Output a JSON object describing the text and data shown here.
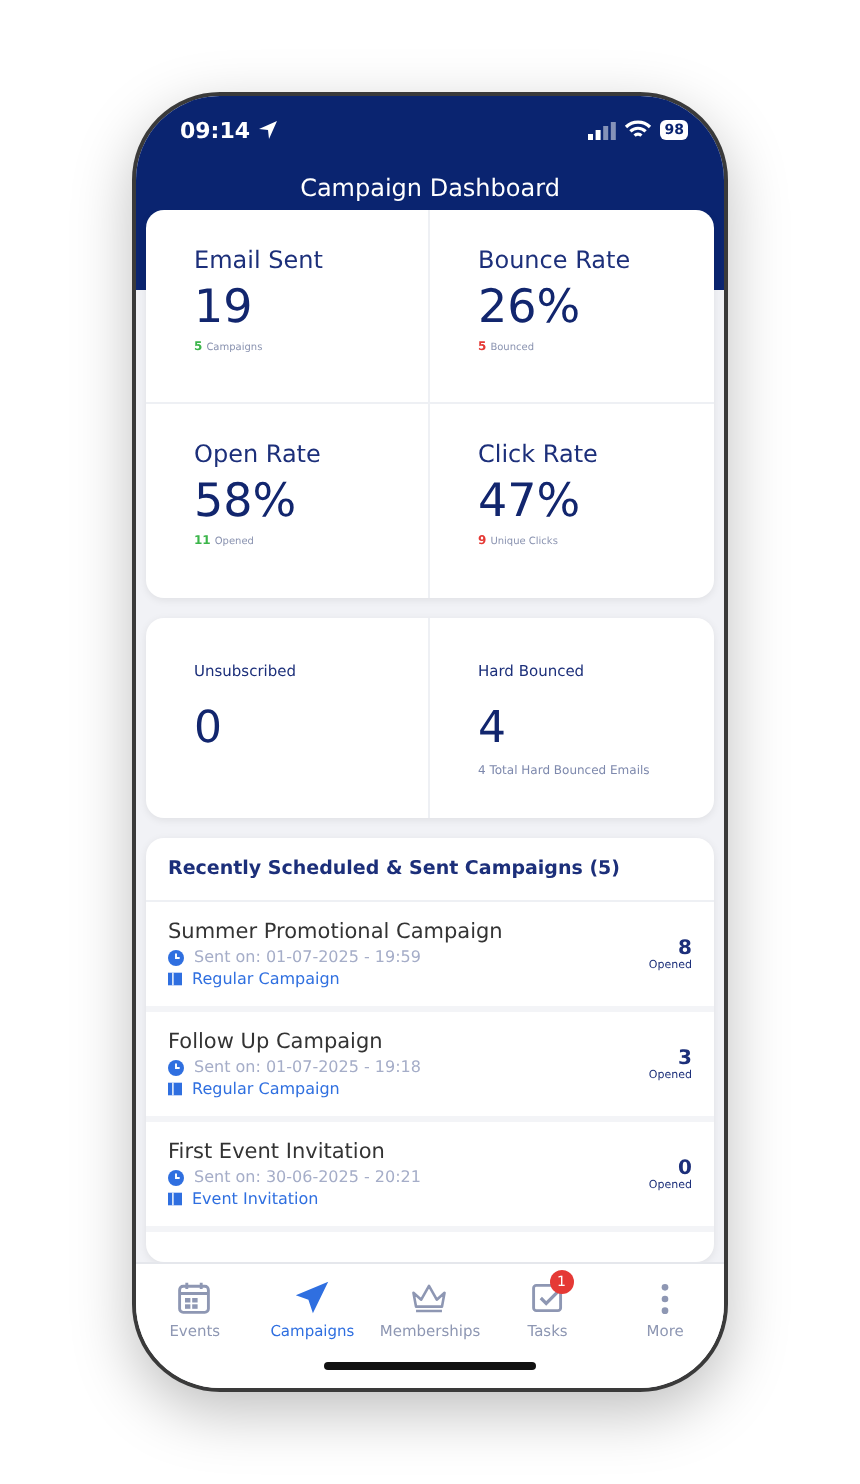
{
  "status_bar": {
    "time": "09:14",
    "battery": "98"
  },
  "title": "Campaign Dashboard",
  "stats": [
    {
      "label": "Email Sent",
      "value": "19",
      "count": "5",
      "note": "Campaigns",
      "color": "#3bb54a"
    },
    {
      "label": "Bounce Rate",
      "value": "26%",
      "count": "5",
      "note": "Bounced",
      "color": "#e53935"
    },
    {
      "label": "Open Rate",
      "value": "58%",
      "count": "11",
      "note": "Opened",
      "color": "#3bb54a"
    },
    {
      "label": "Click Rate",
      "value": "47%",
      "count": "9",
      "note": "Unique Clicks",
      "color": "#e53935"
    }
  ],
  "totals": [
    {
      "label": "Unsubscribed",
      "value": "0"
    },
    {
      "label": "Hard Bounced",
      "value": "4",
      "note": "4 Total Hard Bounced Emails"
    }
  ],
  "campaigns": {
    "title": "Recently Scheduled & Sent Campaigns (5)",
    "items": [
      {
        "name": "Summer Promotional Campaign",
        "sent": "Sent on: 01-07-2025 - 19:59",
        "type": "Regular Campaign",
        "count": "8",
        "count_label": "Opened"
      },
      {
        "name": "Follow Up Campaign",
        "sent": "Sent on: 01-07-2025 - 19:18",
        "type": "Regular Campaign",
        "count": "3",
        "count_label": "Opened"
      },
      {
        "name": "First Event Invitation",
        "sent": "Sent on: 30-06-2025 - 20:21",
        "type": "Event Invitation",
        "count": "0",
        "count_label": "Opened"
      }
    ]
  },
  "tabs": [
    {
      "label": "Events",
      "kind": "calendar",
      "selected": false
    },
    {
      "label": "Campaigns",
      "kind": "plane",
      "selected": true
    },
    {
      "label": "Memberships",
      "kind": "crown",
      "selected": false
    },
    {
      "label": "Tasks",
      "kind": "check",
      "selected": false,
      "badge": "1"
    },
    {
      "label": "More",
      "kind": "dots",
      "selected": false
    }
  ]
}
